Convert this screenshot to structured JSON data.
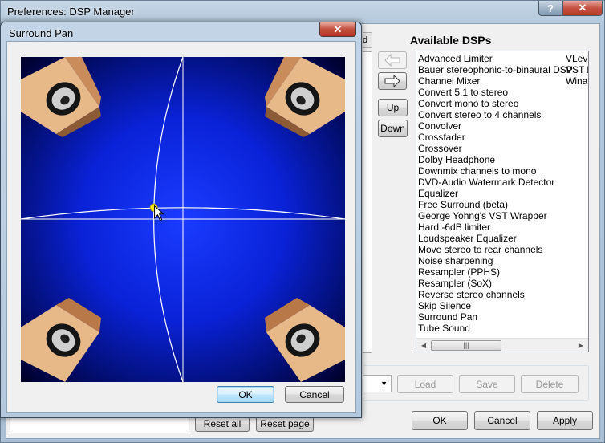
{
  "preferences": {
    "title": "Preferences: DSP Manager",
    "help_label": "?",
    "close_label": "✕",
    "available_title": "Available DSPs",
    "available_dsps": [
      {
        "name": "Advanced Limiter",
        "extra": "VLeve"
      },
      {
        "name": "Bauer stereophonic-to-binaural DSP",
        "extra": "VST b"
      },
      {
        "name": "Channel Mixer",
        "extra": "Winar"
      },
      {
        "name": "Convert 5.1 to stereo",
        "extra": ""
      },
      {
        "name": "Convert mono to stereo",
        "extra": ""
      },
      {
        "name": "Convert stereo to 4 channels",
        "extra": ""
      },
      {
        "name": "Convolver",
        "extra": ""
      },
      {
        "name": "Crossfader",
        "extra": ""
      },
      {
        "name": "Crossover",
        "extra": ""
      },
      {
        "name": "Dolby Headphone",
        "extra": ""
      },
      {
        "name": "Downmix channels to mono",
        "extra": ""
      },
      {
        "name": "DVD-Audio Watermark Detector",
        "extra": ""
      },
      {
        "name": "Equalizer",
        "extra": ""
      },
      {
        "name": "Free Surround (beta)",
        "extra": ""
      },
      {
        "name": "George Yohng's VST Wrapper",
        "extra": ""
      },
      {
        "name": "Hard -6dB limiter",
        "extra": ""
      },
      {
        "name": "Loudspeaker Equalizer",
        "extra": ""
      },
      {
        "name": "Move stereo to rear channels",
        "extra": ""
      },
      {
        "name": "Noise sharpening",
        "extra": ""
      },
      {
        "name": "Resampler (PPHS)",
        "extra": ""
      },
      {
        "name": "Resampler (SoX)",
        "extra": ""
      },
      {
        "name": "Reverse stereo channels",
        "extra": ""
      },
      {
        "name": "Skip Silence",
        "extra": ""
      },
      {
        "name": "Surround Pan",
        "extra": ""
      },
      {
        "name": "Tube Sound",
        "extra": ""
      }
    ],
    "buttons": {
      "up": "Up",
      "down": "Down",
      "load": "Load",
      "save": "Save",
      "delete": "Delete",
      "ok": "OK",
      "cancel": "Cancel",
      "apply": "Apply",
      "reset_all": "Reset all",
      "reset_page": "Reset page"
    }
  },
  "surround_pan": {
    "title": "Surround Pan",
    "close_label": "✕",
    "pan_position": {
      "x": -0.18,
      "y": 0.07
    },
    "ok_label": "OK",
    "cancel_label": "Cancel",
    "colors": {
      "field_center": "#1a3cff",
      "field_edge": "#00002a",
      "speaker_front": "#e8b988",
      "speaker_side": "#b87848"
    }
  }
}
